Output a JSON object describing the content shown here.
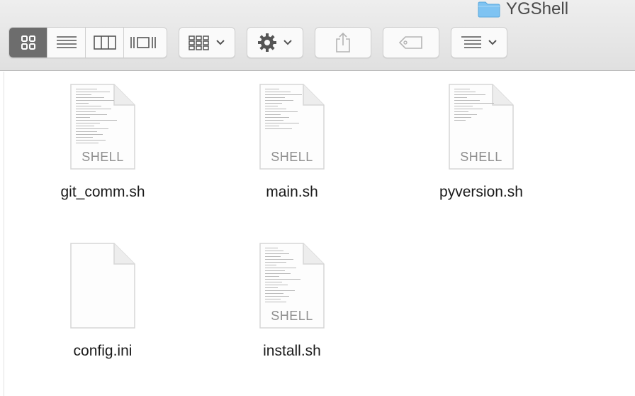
{
  "window": {
    "title": "YGShell"
  },
  "toolbar": {
    "view_modes": [
      {
        "name": "icon-view",
        "icon": "icon-view-icon",
        "active": true
      },
      {
        "name": "list-view",
        "icon": "list-view-icon",
        "active": false
      },
      {
        "name": "column-view",
        "icon": "column-view-icon",
        "active": false
      },
      {
        "name": "cover-flow-view",
        "icon": "cover-flow-icon",
        "active": false
      }
    ],
    "arrange_icon": "arrange-grid-icon",
    "action_icon": "gear-icon",
    "share_icon": "share-icon",
    "tags_icon": "tag-icon",
    "sort_icon": "sort-list-icon"
  },
  "files": [
    {
      "name": "git_comm.sh",
      "kind": "SHELL"
    },
    {
      "name": "main.sh",
      "kind": "SHELL"
    },
    {
      "name": "pyversion.sh",
      "kind": "SHELL"
    },
    {
      "name": "config.ini",
      "kind": ""
    },
    {
      "name": "install.sh",
      "kind": "SHELL"
    }
  ],
  "colors": {
    "folder": "#7ec3f2",
    "active_segment": "#6d6d6d"
  }
}
